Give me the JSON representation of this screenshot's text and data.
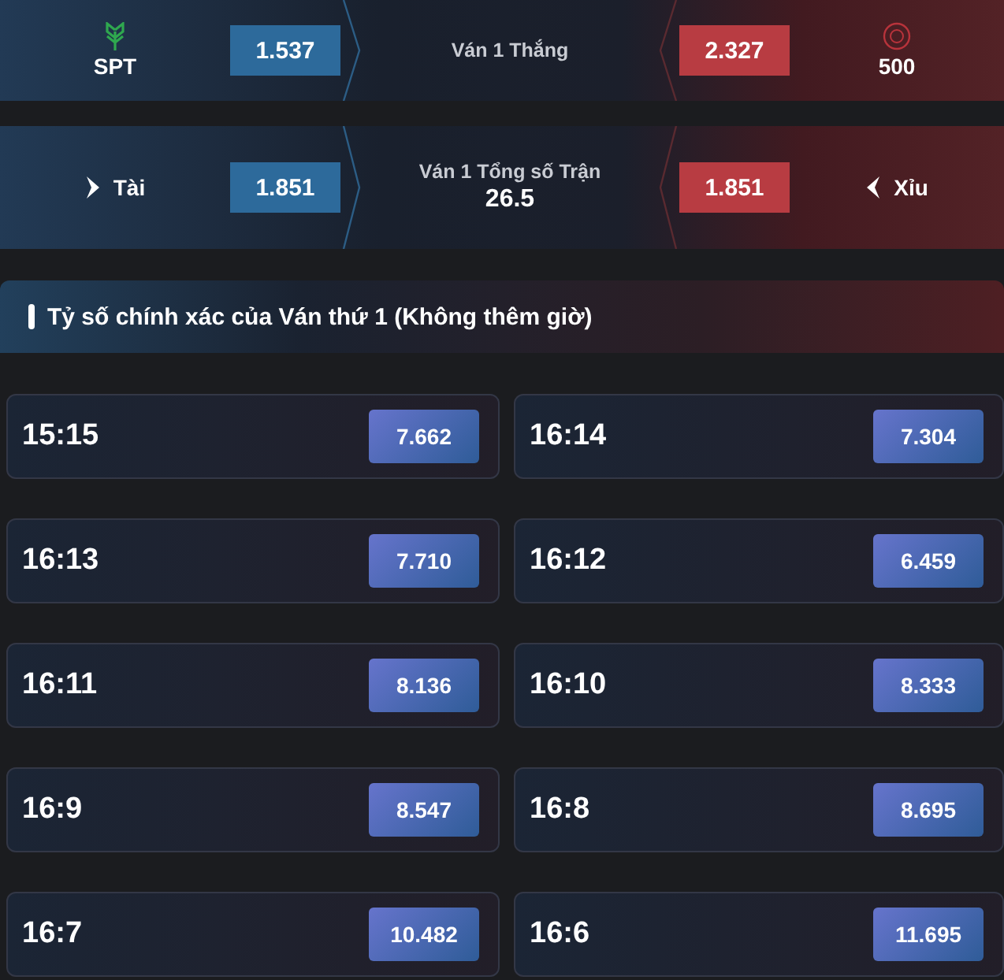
{
  "markets": [
    {
      "left": {
        "kind": "team",
        "label": "SPT"
      },
      "left_odds": "1.537",
      "title": "Ván 1 Thắng",
      "right_odds": "2.327",
      "right": {
        "kind": "team",
        "label": "500"
      }
    },
    {
      "left": {
        "kind": "over",
        "label": "Tài"
      },
      "left_odds": "1.851",
      "title": "Ván 1 Tổng số Trận",
      "line": "26.5",
      "right_odds": "1.851",
      "right": {
        "kind": "under",
        "label": "Xỉu"
      }
    }
  ],
  "section": {
    "title": "Tỷ số chính xác của Ván thứ 1 (Không thêm giờ)"
  },
  "scores": [
    {
      "score": "15:15",
      "odds": "7.662"
    },
    {
      "score": "16:14",
      "odds": "7.304"
    },
    {
      "score": "16:13",
      "odds": "7.710"
    },
    {
      "score": "16:12",
      "odds": "6.459"
    },
    {
      "score": "16:11",
      "odds": "8.136"
    },
    {
      "score": "16:10",
      "odds": "8.333"
    },
    {
      "score": "16:9",
      "odds": "8.547"
    },
    {
      "score": "16:8",
      "odds": "8.695"
    },
    {
      "score": "16:7",
      "odds": "10.482"
    },
    {
      "score": "16:6",
      "odds": "11.695"
    }
  ]
}
